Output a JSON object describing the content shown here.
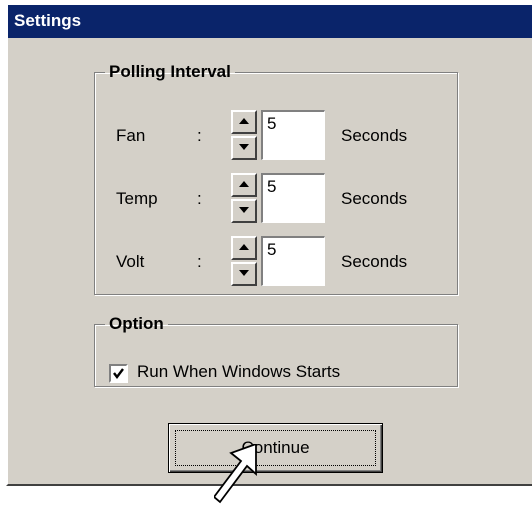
{
  "window": {
    "title": "Settings"
  },
  "polling_group": {
    "title": "Polling Interval",
    "rows": [
      {
        "label": "Fan",
        "colon": ":",
        "value": "5",
        "unit": "Seconds"
      },
      {
        "label": "Temp",
        "colon": ":",
        "value": "5",
        "unit": "Seconds"
      },
      {
        "label": "Volt",
        "colon": ":",
        "value": "5",
        "unit": "Seconds"
      }
    ]
  },
  "option_group": {
    "title": "Option",
    "run_at_startup": {
      "label": "Run When Windows Starts",
      "checked": true
    }
  },
  "continue_button": {
    "label": "Continue"
  },
  "colors": {
    "titlebar": "#0a246a",
    "face": "#d4d0c8"
  }
}
